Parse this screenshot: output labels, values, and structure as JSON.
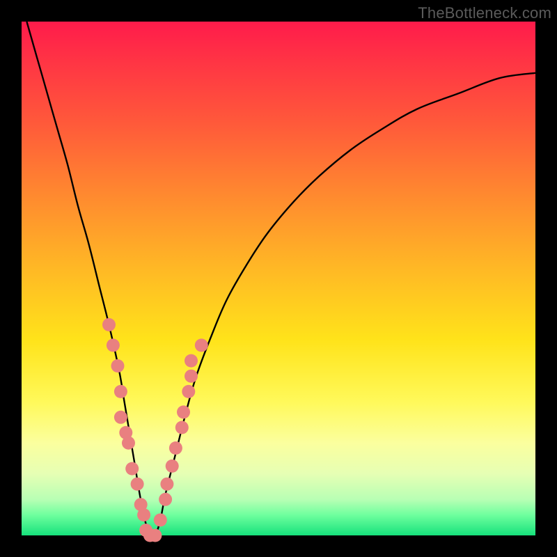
{
  "watermark": {
    "text": "TheBottleneck.com"
  },
  "colors": {
    "background": "#000000",
    "curve": "#000000",
    "marker_fill": "#e98080",
    "marker_stroke": "#b45353",
    "gradient": [
      "#ff1b4b",
      "#ff3544",
      "#ff5a3a",
      "#ff8a2f",
      "#ffb825",
      "#ffe31a",
      "#fff95a",
      "#fbff9e",
      "#e6ffb4",
      "#b8ffb4",
      "#6fff9e",
      "#16e27c"
    ]
  },
  "chart_data": {
    "type": "line",
    "title": "",
    "xlabel": "",
    "ylabel": "",
    "xlim": [
      0,
      100
    ],
    "ylim": [
      0,
      100
    ],
    "series": [
      {
        "name": "curve",
        "x": [
          1,
          3,
          5,
          7,
          9,
          11,
          13,
          15,
          17,
          19,
          20,
          21,
          22,
          23,
          24,
          25,
          26,
          27,
          28,
          30,
          32,
          34,
          37,
          40,
          44,
          48,
          53,
          58,
          64,
          70,
          77,
          85,
          93,
          100
        ],
        "y": [
          100,
          93,
          86,
          79,
          72,
          64,
          57,
          49,
          41,
          32,
          26,
          20,
          14,
          8,
          3,
          0,
          0,
          3,
          8,
          16,
          24,
          31,
          39,
          46,
          53,
          59,
          65,
          70,
          75,
          79,
          83,
          86,
          89,
          90
        ]
      }
    ],
    "markers": [
      {
        "x": 17.0,
        "y": 41
      },
      {
        "x": 17.8,
        "y": 37
      },
      {
        "x": 18.7,
        "y": 33
      },
      {
        "x": 19.3,
        "y": 28
      },
      {
        "x": 19.3,
        "y": 23
      },
      {
        "x": 20.3,
        "y": 20
      },
      {
        "x": 20.8,
        "y": 18
      },
      {
        "x": 21.5,
        "y": 13
      },
      {
        "x": 22.5,
        "y": 10
      },
      {
        "x": 23.2,
        "y": 6
      },
      {
        "x": 23.8,
        "y": 4
      },
      {
        "x": 24.2,
        "y": 1
      },
      {
        "x": 25.0,
        "y": 0
      },
      {
        "x": 26.0,
        "y": 0
      },
      {
        "x": 27.0,
        "y": 3
      },
      {
        "x": 28.0,
        "y": 7
      },
      {
        "x": 28.3,
        "y": 10
      },
      {
        "x": 29.3,
        "y": 13.5
      },
      {
        "x": 30.0,
        "y": 17
      },
      {
        "x": 31.2,
        "y": 21
      },
      {
        "x": 31.5,
        "y": 24
      },
      {
        "x": 32.5,
        "y": 28
      },
      {
        "x": 33.0,
        "y": 31
      },
      {
        "x": 33.0,
        "y": 34
      },
      {
        "x": 35.0,
        "y": 37
      }
    ]
  }
}
